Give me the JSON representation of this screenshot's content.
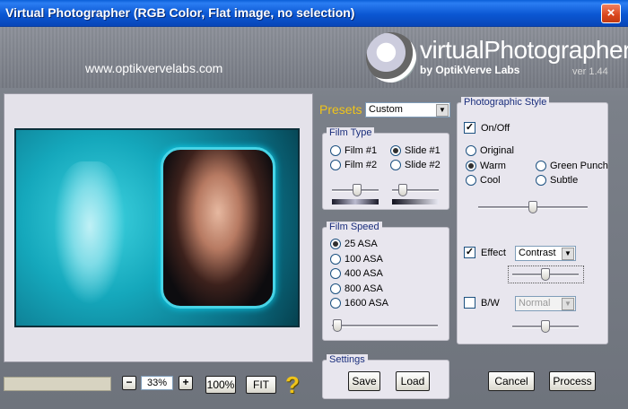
{
  "window": {
    "title": "Virtual Photographer (RGB Color, Flat image, no selection)",
    "close_glyph": "×"
  },
  "header": {
    "site_url": "www.optikvervelabs.com",
    "logo_text": "virtualPhotographer",
    "logo_sub": "by OptikVerve Labs",
    "version": "ver 1.44"
  },
  "presets": {
    "label": "Presets",
    "value": "Custom"
  },
  "film_type": {
    "title": "Film Type",
    "options": [
      {
        "label": "Film #1",
        "checked": false
      },
      {
        "label": "Slide #1",
        "checked": true
      },
      {
        "label": "Film #2",
        "checked": false
      },
      {
        "label": "Slide #2",
        "checked": false
      }
    ]
  },
  "film_speed": {
    "title": "Film Speed",
    "options": [
      {
        "label": "25 ASA",
        "checked": true
      },
      {
        "label": "100 ASA",
        "checked": false
      },
      {
        "label": "400 ASA",
        "checked": false
      },
      {
        "label": "800 ASA",
        "checked": false
      },
      {
        "label": "1600 ASA",
        "checked": false
      }
    ]
  },
  "settings": {
    "title": "Settings",
    "save": "Save",
    "load": "Load"
  },
  "photographic_style": {
    "title": "Photographic Style",
    "on_off": "On/Off",
    "on_off_checked": true,
    "styles": [
      {
        "label": "Original",
        "checked": false
      },
      {
        "label": "Warm",
        "checked": true
      },
      {
        "label": "Green Punch",
        "checked": false
      },
      {
        "label": "Cool",
        "checked": false
      },
      {
        "label": "Subtle",
        "checked": false
      }
    ],
    "effect_label": "Effect",
    "effect_checked": true,
    "effect_value": "Contrast",
    "bw_label": "B/W",
    "bw_checked": false,
    "bw_value": "Normal"
  },
  "zoom": {
    "minus": "−",
    "value": "33%",
    "plus": "+",
    "hundred": "100%",
    "fit": "FIT"
  },
  "help": "?",
  "actions": {
    "cancel": "Cancel",
    "process": "Process"
  },
  "checkmark": "✓"
}
